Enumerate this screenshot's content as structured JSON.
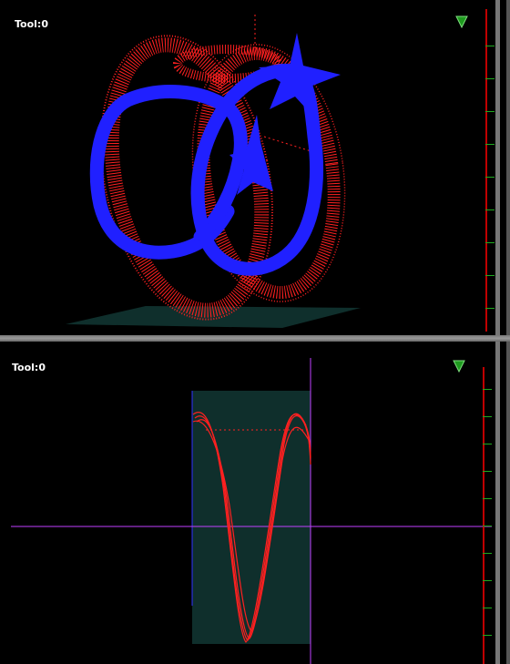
{
  "top_view": {
    "tool_label": "Tool:0"
  },
  "bottom_view": {
    "tool_label": "Tool:0"
  },
  "icons": {
    "indicator": "green-triangle-marker-icon"
  },
  "colors": {
    "background": "#000000",
    "toolpath": "#ff2020",
    "tool_shape": "#2020ff",
    "stock": "#0f2f2c",
    "crosshair": "#c040ff",
    "ruler": "#c00000",
    "ruler_ticks": "#1faa1f"
  }
}
